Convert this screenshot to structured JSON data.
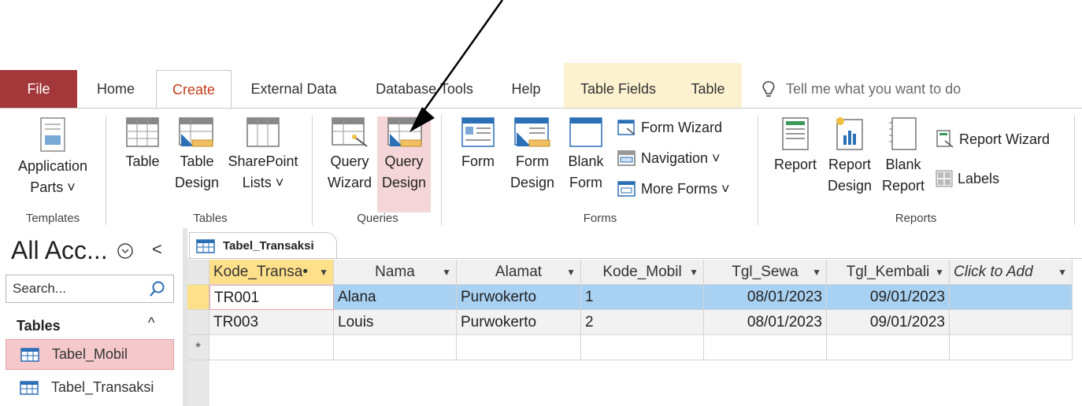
{
  "tabs": {
    "file": "File",
    "home": "Home",
    "create": "Create",
    "external_data": "External Data",
    "database_tools": "Database Tools",
    "help": "Help",
    "table_fields": "Table Fields",
    "table": "Table",
    "tell_me": "Tell me what you want to do"
  },
  "ribbon": {
    "templates": {
      "label": "Templates",
      "application_parts_1": "Application",
      "application_parts_2": "Parts ˅"
    },
    "tables": {
      "label": "Tables",
      "table": "Table",
      "table_design_1": "Table",
      "table_design_2": "Design",
      "sharepoint_1": "SharePoint",
      "sharepoint_2": "Lists ˅"
    },
    "queries": {
      "label": "Queries",
      "query_wizard_1": "Query",
      "query_wizard_2": "Wizard",
      "query_design_1": "Query",
      "query_design_2": "Design"
    },
    "forms": {
      "label": "Forms",
      "form": "Form",
      "form_design_1": "Form",
      "form_design_2": "Design",
      "blank_form_1": "Blank",
      "blank_form_2": "Form",
      "form_wizard": "Form Wizard",
      "navigation": "Navigation ˅",
      "more_forms": "More Forms ˅"
    },
    "reports": {
      "label": "Reports",
      "report": "Report",
      "report_design_1": "Report",
      "report_design_2": "Design",
      "blank_report_1": "Blank",
      "blank_report_2": "Report",
      "report_wizard": "Report Wizard",
      "labels": "Labels"
    }
  },
  "nav": {
    "title": "All Acc...",
    "collapse": "<",
    "search_placeholder": "Search...",
    "section": "Tables",
    "section_toggle": "^",
    "items": [
      "Tabel_Mobil",
      "Tabel_Transaksi"
    ]
  },
  "document": {
    "tab": "Tabel_Transaksi",
    "columns": [
      "Kode_Transa•",
      "Nama",
      "Alamat",
      "Kode_Mobil",
      "Tgl_Sewa",
      "Tgl_Kembali",
      "Click to Add"
    ],
    "rows": [
      [
        "TR001",
        "Alana",
        "Purwokerto",
        "1",
        "08/01/2023",
        "09/01/2023",
        ""
      ],
      [
        "TR003",
        "Louis",
        "Purwokerto",
        "2",
        "08/01/2023",
        "09/01/2023",
        ""
      ]
    ],
    "new_row_marker": "*"
  },
  "colors": {
    "file_tab": "#a4373a",
    "active_tab_text": "#c43e1c",
    "contextual_tabs": "#fdf2d0",
    "highlight": "#f5d6d8",
    "selected_row": "#a9d1f2",
    "selected_header": "#ffe08a"
  }
}
